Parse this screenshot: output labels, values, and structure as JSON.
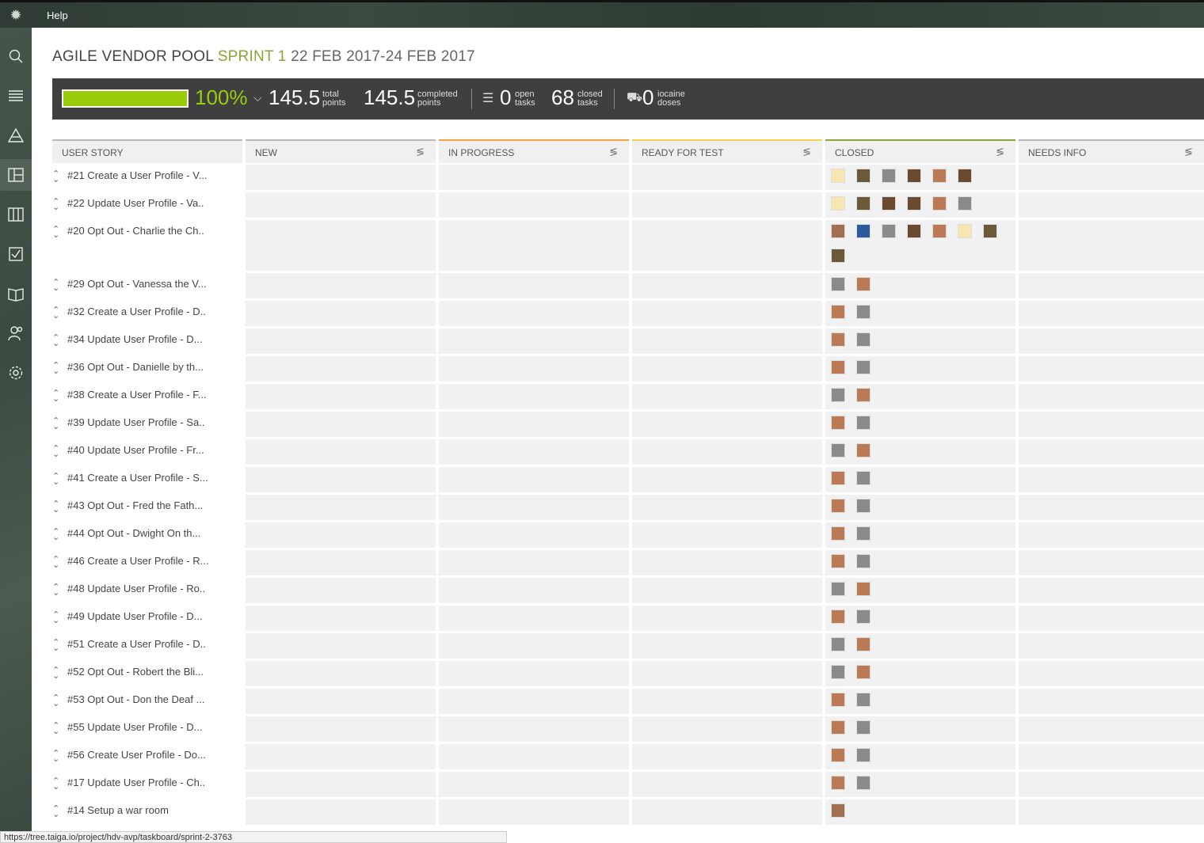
{
  "topbar": {
    "help_label": "Help"
  },
  "sidebar": {
    "items": [
      "search-icon",
      "menu-icon",
      "epic-icon",
      "kanban-icon",
      "backlog-icon",
      "tasks-icon",
      "wiki-icon",
      "team-icon",
      "settings-icon"
    ],
    "active_index": 3
  },
  "title": {
    "project": "AGILE VENDOR POOL",
    "sprint": "SPRINT 1",
    "dates": "22 FEB 2017-24 FEB 2017"
  },
  "stats": {
    "progress_pct": 100,
    "percent_label": "100%",
    "total_points": "145.5",
    "total_label_1": "total",
    "total_label_2": "points",
    "completed_points": "145.5",
    "completed_label_1": "completed",
    "completed_label_2": "points",
    "open_tasks": "0",
    "open_label_1": "open",
    "open_label_2": "tasks",
    "closed_tasks": "68",
    "closed_label_1": "closed",
    "closed_label_2": "tasks",
    "iocaine": "0",
    "iocaine_label_1": "iocaine",
    "iocaine_label_2": "doses"
  },
  "columns": {
    "user_story": "USER STORY",
    "statuses": [
      {
        "label": "NEW",
        "color": "#b9b9b9"
      },
      {
        "label": "IN PROGRESS",
        "color": "#f0a040"
      },
      {
        "label": "READY FOR TEST",
        "color": "#f2d24b"
      },
      {
        "label": "CLOSED",
        "color": "#8aa53a"
      },
      {
        "label": "NEEDS INFO",
        "color": "#b9b9b9"
      }
    ]
  },
  "stories": [
    {
      "label": "#21 Create a User Profile - V...",
      "avatars": [
        "smile",
        "mtn",
        "cat",
        "burger",
        "woman",
        "burger"
      ]
    },
    {
      "label": "#22 Update User Profile - Va..",
      "avatars": [
        "smile",
        "mtn",
        "burger",
        "burger",
        "woman",
        "cat"
      ]
    },
    {
      "label": "#20 Opt Out - Charlie the Ch..",
      "avatars": [
        "man",
        "globe",
        "cat",
        "burger",
        "woman",
        "smile",
        "mtn",
        "mtn"
      ]
    },
    {
      "label": "#29 Opt Out - Vanessa the V...",
      "avatars": [
        "cat",
        "woman"
      ]
    },
    {
      "label": "#32 Create a User Profile - D..",
      "avatars": [
        "woman",
        "cat"
      ]
    },
    {
      "label": "#34 Update User Profile - D...",
      "avatars": [
        "woman",
        "cat"
      ]
    },
    {
      "label": "#36 Opt Out - Danielle by th...",
      "avatars": [
        "woman",
        "cat"
      ]
    },
    {
      "label": "#38 Create a User Profile - F...",
      "avatars": [
        "cat",
        "woman"
      ]
    },
    {
      "label": "#39 Update User Profile - Sa..",
      "avatars": [
        "woman",
        "cat"
      ]
    },
    {
      "label": "#40 Update User Profile - Fr...",
      "avatars": [
        "cat",
        "woman"
      ]
    },
    {
      "label": "#41 Create a User Profile - S...",
      "avatars": [
        "woman",
        "cat"
      ]
    },
    {
      "label": "#43 Opt Out - Fred the Fath...",
      "avatars": [
        "woman",
        "cat"
      ]
    },
    {
      "label": "#44 Opt Out - Dwight On th...",
      "avatars": [
        "woman",
        "cat"
      ]
    },
    {
      "label": "#46 Create a User Profile - R...",
      "avatars": [
        "woman",
        "cat"
      ]
    },
    {
      "label": "#48 Update User Profile - Ro..",
      "avatars": [
        "cat",
        "woman"
      ]
    },
    {
      "label": "#49 Update User Profile - D...",
      "avatars": [
        "woman",
        "cat"
      ]
    },
    {
      "label": "#51 Create a User Profile - D..",
      "avatars": [
        "cat",
        "woman"
      ]
    },
    {
      "label": "#52 Opt Out - Robert the Bli...",
      "avatars": [
        "cat",
        "woman"
      ]
    },
    {
      "label": "#53 Opt Out - Don the Deaf ...",
      "avatars": [
        "woman",
        "cat"
      ]
    },
    {
      "label": "#55 Update User Profile - D...",
      "avatars": [
        "woman",
        "cat"
      ]
    },
    {
      "label": "#56 Create User Profile - Do...",
      "avatars": [
        "woman",
        "cat"
      ]
    },
    {
      "label": "#17 Update User Profile - Ch..",
      "avatars": [
        "woman",
        "cat"
      ]
    },
    {
      "label": "#14 Setup a war room",
      "avatars": [
        "man"
      ]
    }
  ],
  "avatar_colors": {
    "smile": "#f6e7b0",
    "mtn": "#6b5a3a",
    "cat": "#8a8a8a",
    "burger": "#6a4a30",
    "woman": "#b97a55",
    "man": "#a07050",
    "globe": "#2a5a9a"
  },
  "status_url": "https://tree.taiga.io/project/hdv-avp/taskboard/sprint-2-3763"
}
